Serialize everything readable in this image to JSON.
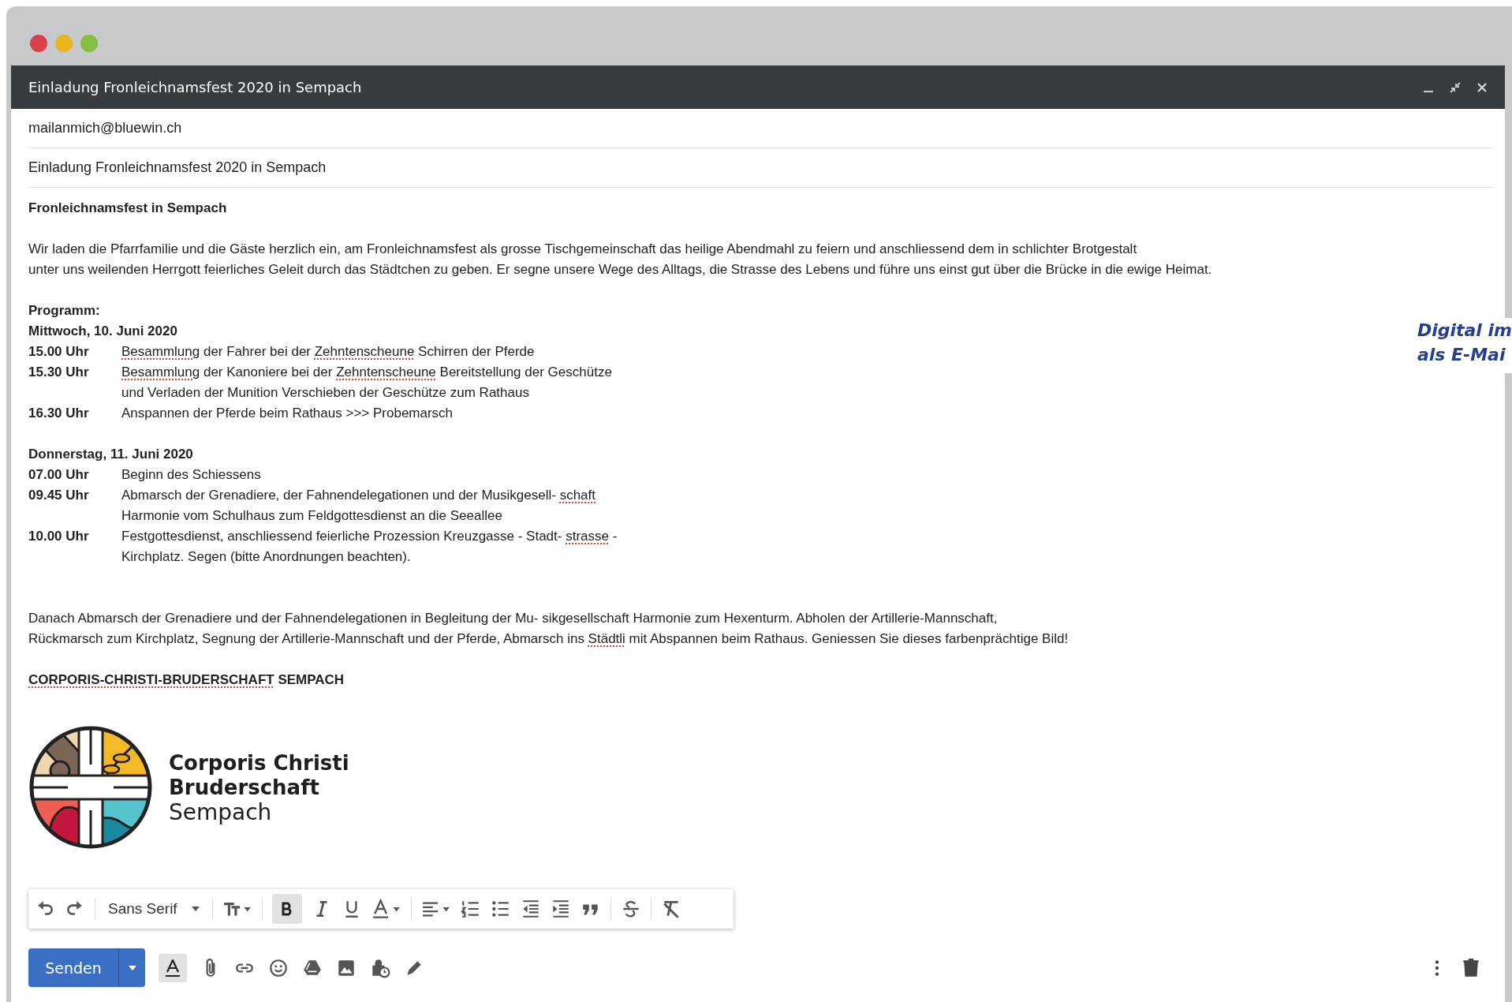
{
  "compose": {
    "title": "Einladung Fronleichnamsfest 2020 in Sempach",
    "recipient": "mailanmich@bluewin.ch",
    "subject": "Einladung Fronleichnamsfest 2020 in Sempach"
  },
  "body": {
    "heading": "Fronleichnamsfest in Sempach",
    "intro": [
      [
        {
          "text": "Wir laden die Pfarrfamilie und die Gäste herzlich ein, am Fronleichnamsfest als grosse Tischgemeinschaft das heilige Abendmahl zu feiern und anschliessend dem in schlichter Brotgestalt"
        }
      ],
      [
        {
          "text": "unter uns weilenden Herrgott feierliches Geleit durch das Städtchen zu geben. Er segne unsere Wege des Alltags, die Strasse des Lebens und führe uns einst gut über die Brücke in die ewige Heimat."
        }
      ]
    ],
    "program_label": "Programm:",
    "days": [
      {
        "date": "Mittwoch, 10. Juni 2020",
        "items": [
          {
            "time": "15.00 Uhr",
            "lines": [
              [
                {
                  "text": "Besammlung",
                  "misspelled": true
                },
                {
                  "text": " der Fahrer bei der "
                },
                {
                  "text": "Zehntenscheune",
                  "misspelled": true
                },
                {
                  "text": " Schirren der Pferde"
                }
              ]
            ]
          },
          {
            "time": "15.30 Uhr",
            "lines": [
              [
                {
                  "text": "Besammlung",
                  "misspelled": true
                },
                {
                  "text": " der Kanoniere bei der "
                },
                {
                  "text": "Zehntenscheune",
                  "misspelled": true
                },
                {
                  "text": " Bereitstellung der Geschütze"
                }
              ],
              [
                {
                  "text": "und Verladen der Munition Verschieben der Geschütze zum Rathaus"
                }
              ]
            ]
          },
          {
            "time": "16.30 Uhr",
            "lines": [
              [
                {
                  "text": "Anspannen der Pferde beim Rathaus >>> Probemarsch"
                }
              ]
            ]
          }
        ]
      },
      {
        "date": "Donnerstag, 11. Juni 2020",
        "items": [
          {
            "time": "07.00 Uhr",
            "lines": [
              [
                {
                  "text": "Beginn des Schiessens"
                }
              ]
            ]
          },
          {
            "time": "09.45 Uhr",
            "lines": [
              [
                {
                  "text": "Abmarsch der Grenadiere, der Fahnendelegationen und der Musikgesell- "
                },
                {
                  "text": "schaft",
                  "misspelled": true
                }
              ],
              [
                {
                  "text": "Harmonie vom Schulhaus zum Feldgottesdienst an die Seeallee"
                }
              ]
            ]
          },
          {
            "time": "10.00 Uhr",
            "lines": [
              [
                {
                  "text": "Festgottesdienst, anschliessend feierliche Prozession Kreuzgasse - Stadt- "
                },
                {
                  "text": "strasse",
                  "misspelled": true
                },
                {
                  "text": " -"
                }
              ],
              [
                {
                  "text": "Kirchplatz. Segen (bitte Anordnungen beachten)."
                }
              ]
            ]
          }
        ]
      }
    ],
    "closing": [
      [
        {
          "text": "Danach Abmarsch der Grenadiere und der Fahnendelegationen in Begleitung der Mu- sikgesellschaft Harmonie zum Hexenturm. Abholen der Artillerie-Mannschaft,"
        }
      ],
      [
        {
          "text": "Rückmarsch zum Kirchplatz, Segnung der Artillerie-Mannschaft und der Pferde, Abmarsch ins "
        },
        {
          "text": "Städtli",
          "misspelled": true
        },
        {
          "text": " mit Abspannen beim Rathaus. Geniessen Sie dieses farbenprächtige Bild!"
        }
      ]
    ],
    "signature": [
      {
        "text": "CORPORIS-CHRISTI-BRUDERSCHAFT",
        "misspelled": true
      },
      {
        "text": " SEMPACH"
      }
    ],
    "logo_lines": [
      "Corporis Christi",
      "Bruderschaft",
      "Sempach"
    ]
  },
  "format_bar": {
    "font_family": "Sans Serif",
    "bold_on": true
  },
  "actions": {
    "send": "Senden",
    "formatting_on": true
  },
  "background_page": {
    "lines": [
      "Digital im",
      "als E-Mai"
    ]
  }
}
